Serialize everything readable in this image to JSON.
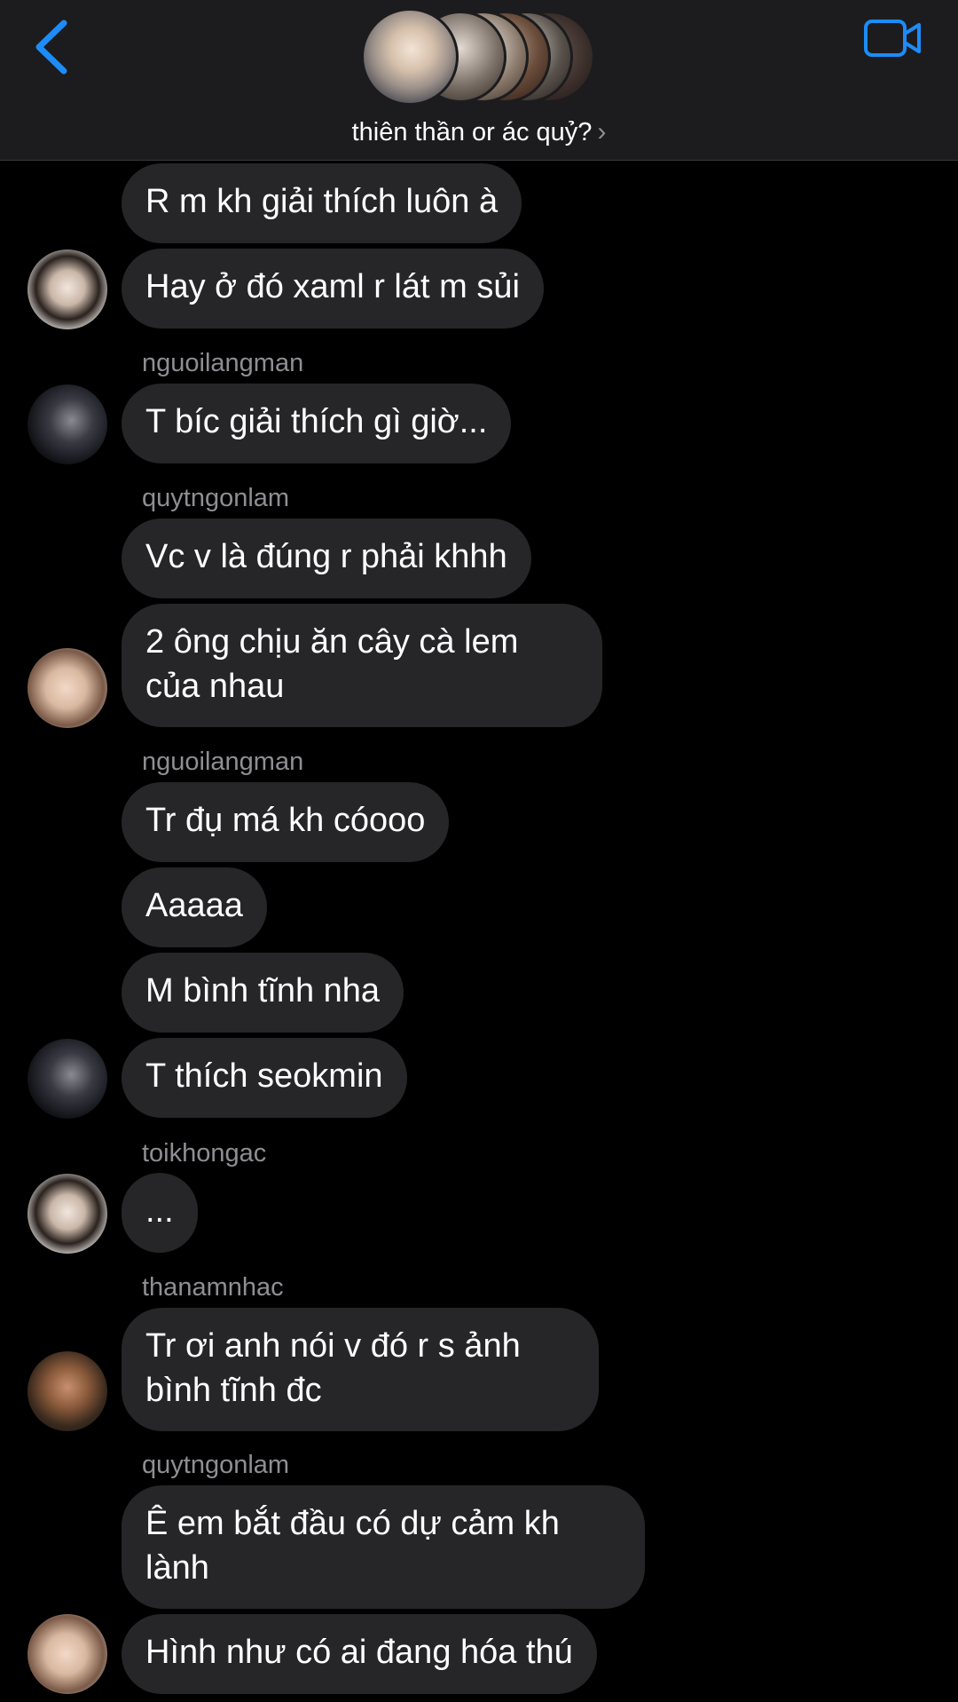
{
  "header": {
    "group_title": "thiên thần or ác quỷ?",
    "title_chevron": "›",
    "back_icon": "chevron-left-icon",
    "video_icon": "video-camera-icon",
    "accent_color": "#1d8cf8"
  },
  "messages": [
    {
      "text": "R m kh giải thích luôn à"
    },
    {
      "text": "Hay ở đó xaml r lát m sủi"
    },
    {
      "sender": "nguoilangman"
    },
    {
      "text": "T bíc giải thích gì giờ..."
    },
    {
      "sender": "quytngonlam"
    },
    {
      "text": "Vc v là đúng r phải khhh"
    },
    {
      "text": "2 ông chịu ăn cây cà lem của nhau"
    },
    {
      "sender": "nguoilangman"
    },
    {
      "text": "Tr đụ má kh cóooo"
    },
    {
      "text": "Aaaaa"
    },
    {
      "text": "M bình tĩnh nha"
    },
    {
      "text": "T thích seokmin"
    },
    {
      "sender": "toikhongac"
    },
    {
      "text": "..."
    },
    {
      "sender": "thanamnhac"
    },
    {
      "text": "Tr ơi anh nói v đó r s ảnh bình tĩnh đc"
    },
    {
      "sender": "quytngonlam"
    },
    {
      "text": "Ê em bắt đầu có dự cảm kh lành"
    },
    {
      "text": "Hình như có ai đang hóa thú"
    }
  ]
}
